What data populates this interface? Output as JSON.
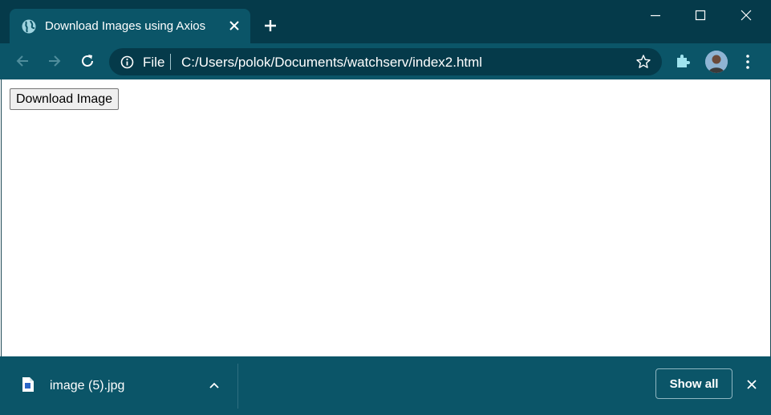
{
  "tab": {
    "title": "Download Images using Axios"
  },
  "omnibox": {
    "scheme_label": "File",
    "url": "C:/Users/polok/Documents/watchserv/index2.html"
  },
  "page": {
    "download_button_label": "Download Image"
  },
  "download_shelf": {
    "filename": "image (5).jpg",
    "show_all_label": "Show all"
  },
  "colors": {
    "titlebar": "#053a4a",
    "toolbar": "#0b5568",
    "omnibox": "#053a4a",
    "page_bg": "#ffffff"
  },
  "icons": [
    "globe-icon",
    "close-icon",
    "plus-icon",
    "minimize-icon",
    "maximize-icon",
    "back-icon",
    "forward-icon",
    "reload-icon",
    "info-icon",
    "star-icon",
    "puzzle-icon",
    "avatar",
    "kebab-menu-icon",
    "file-icon",
    "chevron-up-icon"
  ]
}
